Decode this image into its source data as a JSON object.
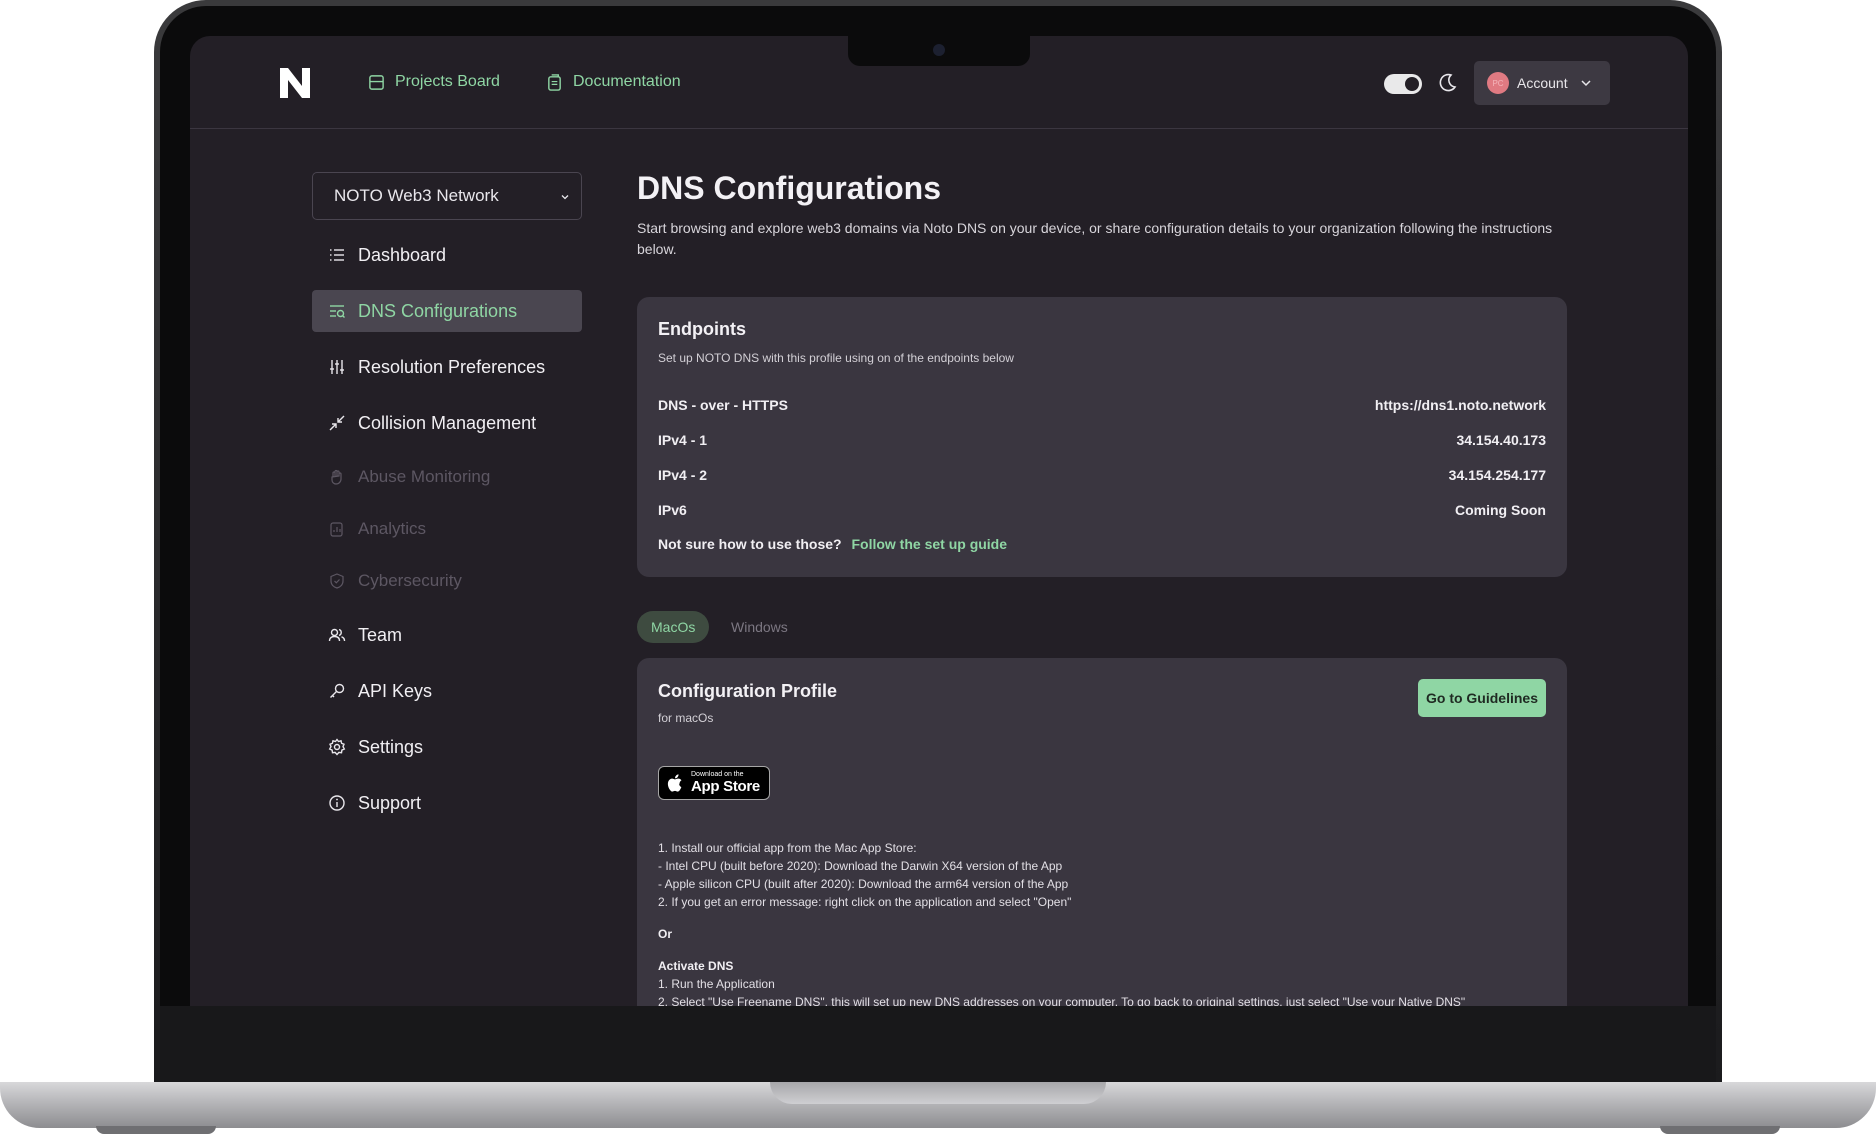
{
  "nav": {
    "links": [
      {
        "label": "Projects Board",
        "icon": "board-icon"
      },
      {
        "label": "Documentation",
        "icon": "document-icon"
      }
    ],
    "theme_toggle": "on",
    "account": {
      "label": "Account",
      "avatar_initials": "PC"
    }
  },
  "sidebar": {
    "network_select": "NOTO Web3 Network",
    "items": [
      {
        "label": "Dashboard",
        "icon": "list-icon",
        "state": "normal"
      },
      {
        "label": "DNS Configurations",
        "icon": "dns-icon",
        "state": "active"
      },
      {
        "label": "Resolution Preferences",
        "icon": "sliders-icon",
        "state": "normal"
      },
      {
        "label": "Collision Management",
        "icon": "collapse-arrows-icon",
        "state": "normal"
      },
      {
        "label": "Abuse Monitoring",
        "icon": "hand-icon",
        "state": "disabled"
      },
      {
        "label": "Analytics",
        "icon": "analytics-icon",
        "state": "disabled"
      },
      {
        "label": "Cybersecurity",
        "icon": "shield-icon",
        "state": "disabled"
      },
      {
        "label": "Team",
        "icon": "team-icon",
        "state": "normal"
      },
      {
        "label": "API Keys",
        "icon": "key-icon",
        "state": "normal"
      },
      {
        "label": "Settings",
        "icon": "gear-icon",
        "state": "normal"
      },
      {
        "label": "Support",
        "icon": "info-icon",
        "state": "normal"
      }
    ]
  },
  "main": {
    "title": "DNS Configurations",
    "description": "Start browsing and explore web3 domains via Noto DNS on your device, or share configuration details to your organization following the instructions below.",
    "endpoints": {
      "title": "Endpoints",
      "subtitle": "Set up NOTO DNS with this profile using on of the endpoints below",
      "rows": [
        {
          "key": "DNS - over - HTTPS",
          "value": "https://dns1.noto.network"
        },
        {
          "key": "IPv4 - 1",
          "value": "34.154.40.173"
        },
        {
          "key": "IPv4 - 2",
          "value": "34.154.254.177"
        },
        {
          "key": "IPv6",
          "value": "Coming Soon"
        }
      ],
      "help_text": "Not sure how to use those?",
      "help_link": "Follow the set up guide"
    },
    "os_tabs": [
      {
        "label": "MacOs",
        "active": true
      },
      {
        "label": "Windows",
        "active": false
      }
    ],
    "profile": {
      "title": "Configuration Profile",
      "subtitle": "for macOs",
      "button": "Go to Guidelines",
      "appstore_small": "Download on the",
      "appstore_big": "App Store",
      "instructions": [
        "1. Install our official app from the Mac App Store:",
        "- Intel CPU (built before 2020): Download the Darwin X64 version of the App",
        "- Apple silicon CPU (built after 2020): Download the arm64 version of the App",
        "2. If you get an error message: right click on the application and select \"Open\""
      ],
      "or_label": "Or",
      "activate_title": "Activate DNS",
      "activate_steps": [
        "1. Run the Application",
        "2. Select \"Use Freename DNS\", this will set up new DNS addresses on your computer. To go back to original settings, just select \"Use your Native DNS\""
      ]
    }
  }
}
